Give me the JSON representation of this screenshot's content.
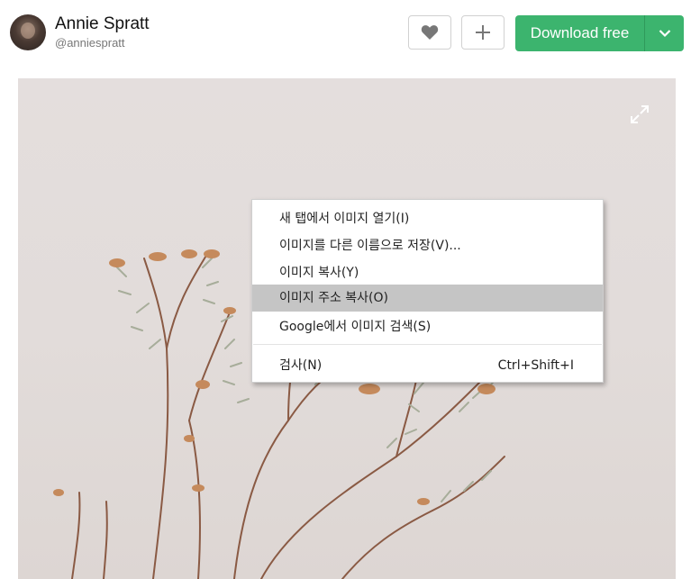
{
  "user": {
    "name": "Annie Spratt",
    "handle": "@anniespratt"
  },
  "actions": {
    "like": "heart-icon",
    "add": "plus-icon",
    "download_label": "Download free",
    "download_options": "chevron-down-icon"
  },
  "photo": {
    "expand": "expand-icon"
  },
  "context_menu": {
    "items": [
      {
        "label": "새 탭에서 이미지 열기(I)"
      },
      {
        "label": "이미지를 다른 이름으로 저장(V)..."
      },
      {
        "label": "이미지 복사(Y)"
      },
      {
        "label": "이미지 주소 복사(O)",
        "highlighted": true
      },
      {
        "label": "Google에서 이미지 검색(S)"
      },
      {
        "label": "검사(N)",
        "shortcut": "Ctrl+Shift+I"
      }
    ]
  },
  "colors": {
    "accent": "#3cb46e",
    "highlight": "#c5c5c5"
  }
}
